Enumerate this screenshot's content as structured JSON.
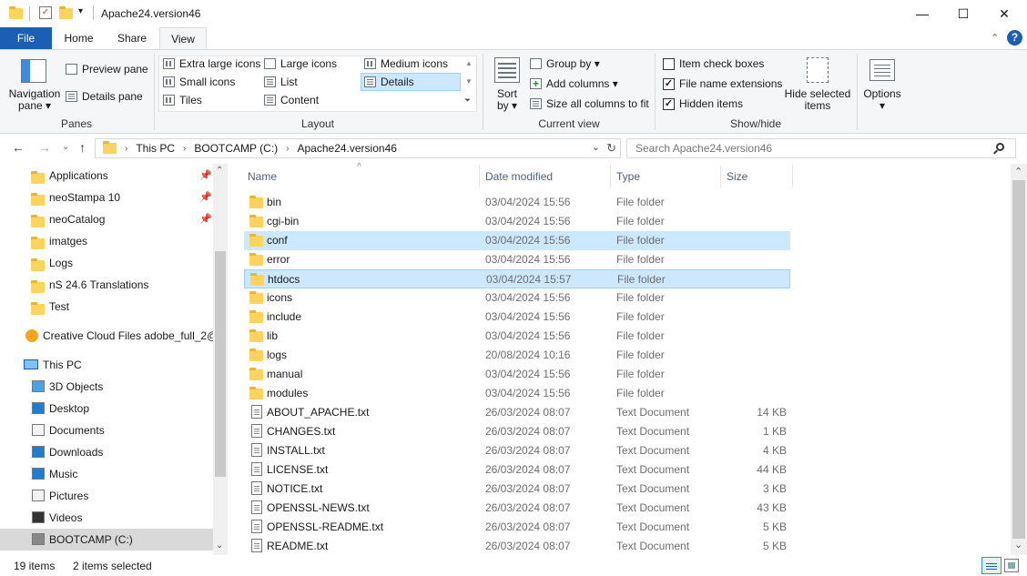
{
  "window": {
    "title": "Apache24.version46",
    "minimize": "—",
    "maximize": "☐",
    "close": "✕"
  },
  "ribbon_tabs": [
    {
      "label": "File"
    },
    {
      "label": "Home"
    },
    {
      "label": "Share"
    },
    {
      "label": "View"
    }
  ],
  "ribbon": {
    "panes": {
      "navigation_pane": "Navigation\npane",
      "navigation_pane_l1": "Navigation",
      "navigation_pane_l2": "pane ▾",
      "preview_pane": "Preview pane",
      "details_pane": "Details pane",
      "group": "Panes"
    },
    "layout": {
      "items": [
        "Extra large icons",
        "Large icons",
        "Medium icons",
        "Small icons",
        "List",
        "Details",
        "Tiles",
        "Content"
      ],
      "selected": "Details",
      "group": "Layout"
    },
    "current_view": {
      "sort_l1": "Sort",
      "sort_l2": "by ▾",
      "group_by": "Group by ▾",
      "add_columns": "Add columns ▾",
      "size_all": "Size all columns to fit",
      "group": "Current view"
    },
    "show_hide": {
      "item_check_boxes": "Item check boxes",
      "item_check_boxes_checked": false,
      "file_name_extensions": "File name extensions",
      "file_name_extensions_checked": true,
      "hidden_items": "Hidden items",
      "hidden_items_checked": true,
      "hide_selected_l1": "Hide selected",
      "hide_selected_l2": "items",
      "group": "Show/hide"
    },
    "options": {
      "label": "Options",
      "arrow": "▾"
    }
  },
  "address": {
    "crumbs": [
      "This PC",
      "BOOTCAMP (C:)",
      "Apache24.version46"
    ],
    "search_placeholder": "Search Apache24.version46"
  },
  "nav": {
    "quick_access": [
      {
        "label": "Applications",
        "pinned": true
      },
      {
        "label": "neoStampa 10",
        "pinned": true
      },
      {
        "label": "neoCatalog",
        "pinned": true
      },
      {
        "label": "imatges",
        "pinned": false
      },
      {
        "label": "Logs",
        "pinned": false
      },
      {
        "label": "nS 24.6 Translations",
        "pinned": false
      },
      {
        "label": "Test",
        "pinned": false
      }
    ],
    "creative_cloud": "Creative Cloud Files  adobe_full_2@",
    "this_pc": "This PC",
    "this_pc_items": [
      {
        "label": "3D Objects"
      },
      {
        "label": "Desktop"
      },
      {
        "label": "Documents"
      },
      {
        "label": "Downloads"
      },
      {
        "label": "Music"
      },
      {
        "label": "Pictures"
      },
      {
        "label": "Videos"
      },
      {
        "label": "BOOTCAMP (C:)"
      }
    ]
  },
  "columns": {
    "name": "Name",
    "date": "Date modified",
    "type": "Type",
    "size": "Size"
  },
  "files": [
    {
      "name": "bin",
      "date": "03/04/2024 15:56",
      "type": "File folder",
      "size": "",
      "kind": "folder"
    },
    {
      "name": "cgi-bin",
      "date": "03/04/2024 15:56",
      "type": "File folder",
      "size": "",
      "kind": "folder"
    },
    {
      "name": "conf",
      "date": "03/04/2024 15:56",
      "type": "File folder",
      "size": "",
      "kind": "folder",
      "selected": true
    },
    {
      "name": "error",
      "date": "03/04/2024 15:56",
      "type": "File folder",
      "size": "",
      "kind": "folder"
    },
    {
      "name": "htdocs",
      "date": "03/04/2024 15:57",
      "type": "File folder",
      "size": "",
      "kind": "folder",
      "selected": true,
      "focused": true
    },
    {
      "name": "icons",
      "date": "03/04/2024 15:56",
      "type": "File folder",
      "size": "",
      "kind": "folder"
    },
    {
      "name": "include",
      "date": "03/04/2024 15:56",
      "type": "File folder",
      "size": "",
      "kind": "folder"
    },
    {
      "name": "lib",
      "date": "03/04/2024 15:56",
      "type": "File folder",
      "size": "",
      "kind": "folder"
    },
    {
      "name": "logs",
      "date": "20/08/2024 10:16",
      "type": "File folder",
      "size": "",
      "kind": "folder"
    },
    {
      "name": "manual",
      "date": "03/04/2024 15:56",
      "type": "File folder",
      "size": "",
      "kind": "folder"
    },
    {
      "name": "modules",
      "date": "03/04/2024 15:56",
      "type": "File folder",
      "size": "",
      "kind": "folder"
    },
    {
      "name": "ABOUT_APACHE.txt",
      "date": "26/03/2024 08:07",
      "type": "Text Document",
      "size": "14 KB",
      "kind": "doc"
    },
    {
      "name": "CHANGES.txt",
      "date": "26/03/2024 08:07",
      "type": "Text Document",
      "size": "1 KB",
      "kind": "doc"
    },
    {
      "name": "INSTALL.txt",
      "date": "26/03/2024 08:07",
      "type": "Text Document",
      "size": "4 KB",
      "kind": "doc"
    },
    {
      "name": "LICENSE.txt",
      "date": "26/03/2024 08:07",
      "type": "Text Document",
      "size": "44 KB",
      "kind": "doc"
    },
    {
      "name": "NOTICE.txt",
      "date": "26/03/2024 08:07",
      "type": "Text Document",
      "size": "3 KB",
      "kind": "doc"
    },
    {
      "name": "OPENSSL-NEWS.txt",
      "date": "26/03/2024 08:07",
      "type": "Text Document",
      "size": "43 KB",
      "kind": "doc"
    },
    {
      "name": "OPENSSL-README.txt",
      "date": "26/03/2024 08:07",
      "type": "Text Document",
      "size": "5 KB",
      "kind": "doc"
    },
    {
      "name": "README.txt",
      "date": "26/03/2024 08:07",
      "type": "Text Document",
      "size": "5 KB",
      "kind": "doc"
    }
  ],
  "status": {
    "count": "19 items",
    "selected": "2 items selected"
  },
  "colors": {
    "accent": "#1a5fb4",
    "selection": "#cce8ff",
    "folder": "#ffd35c"
  }
}
